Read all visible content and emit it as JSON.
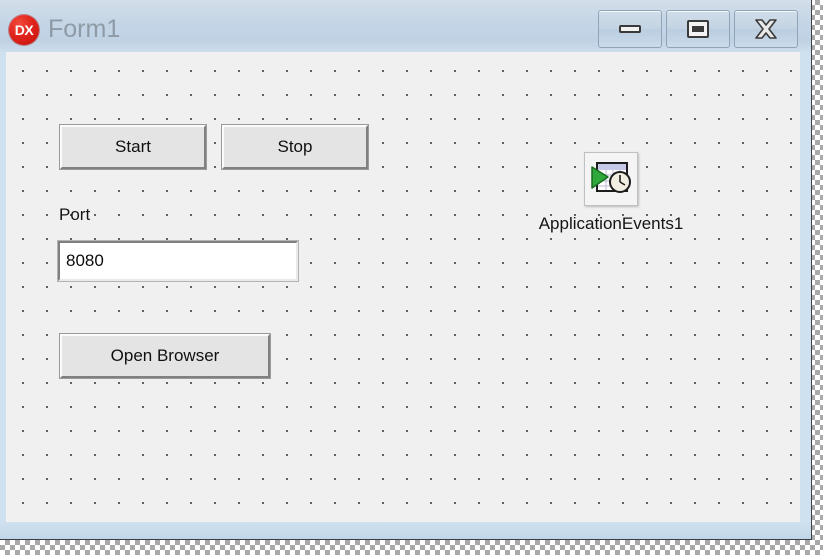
{
  "window": {
    "title": "Form1",
    "icon_name": "dx-logo-icon",
    "icon_text": "DX",
    "icon_color": "#d8231c",
    "titlebar_text_color": "#8e9aa6",
    "controls": [
      {
        "name": "minimize-button",
        "glyph": "minimize-icon",
        "label": "Minimize"
      },
      {
        "name": "maximize-button",
        "glyph": "maximize-icon",
        "label": "Maximize"
      },
      {
        "name": "close-button",
        "glyph": "close-icon",
        "label": "Close"
      }
    ]
  },
  "designer": {
    "surface_color": "#f0f0f0",
    "grid_dot_color": "#4a4a4a",
    "grid_spacing_px": 24,
    "frame_color": "#cfe0ef"
  },
  "controls": {
    "start_button": {
      "label": "Start"
    },
    "stop_button": {
      "label": "Stop"
    },
    "port_label": {
      "text": "Port"
    },
    "port_input": {
      "value": "8080",
      "placeholder": ""
    },
    "open_browser_button": {
      "label": "Open Browser"
    }
  },
  "component_tray": {
    "items": [
      {
        "name": "ApplicationEvents1",
        "label": "ApplicationEvents1",
        "icon_name": "application-events-icon"
      }
    ]
  }
}
